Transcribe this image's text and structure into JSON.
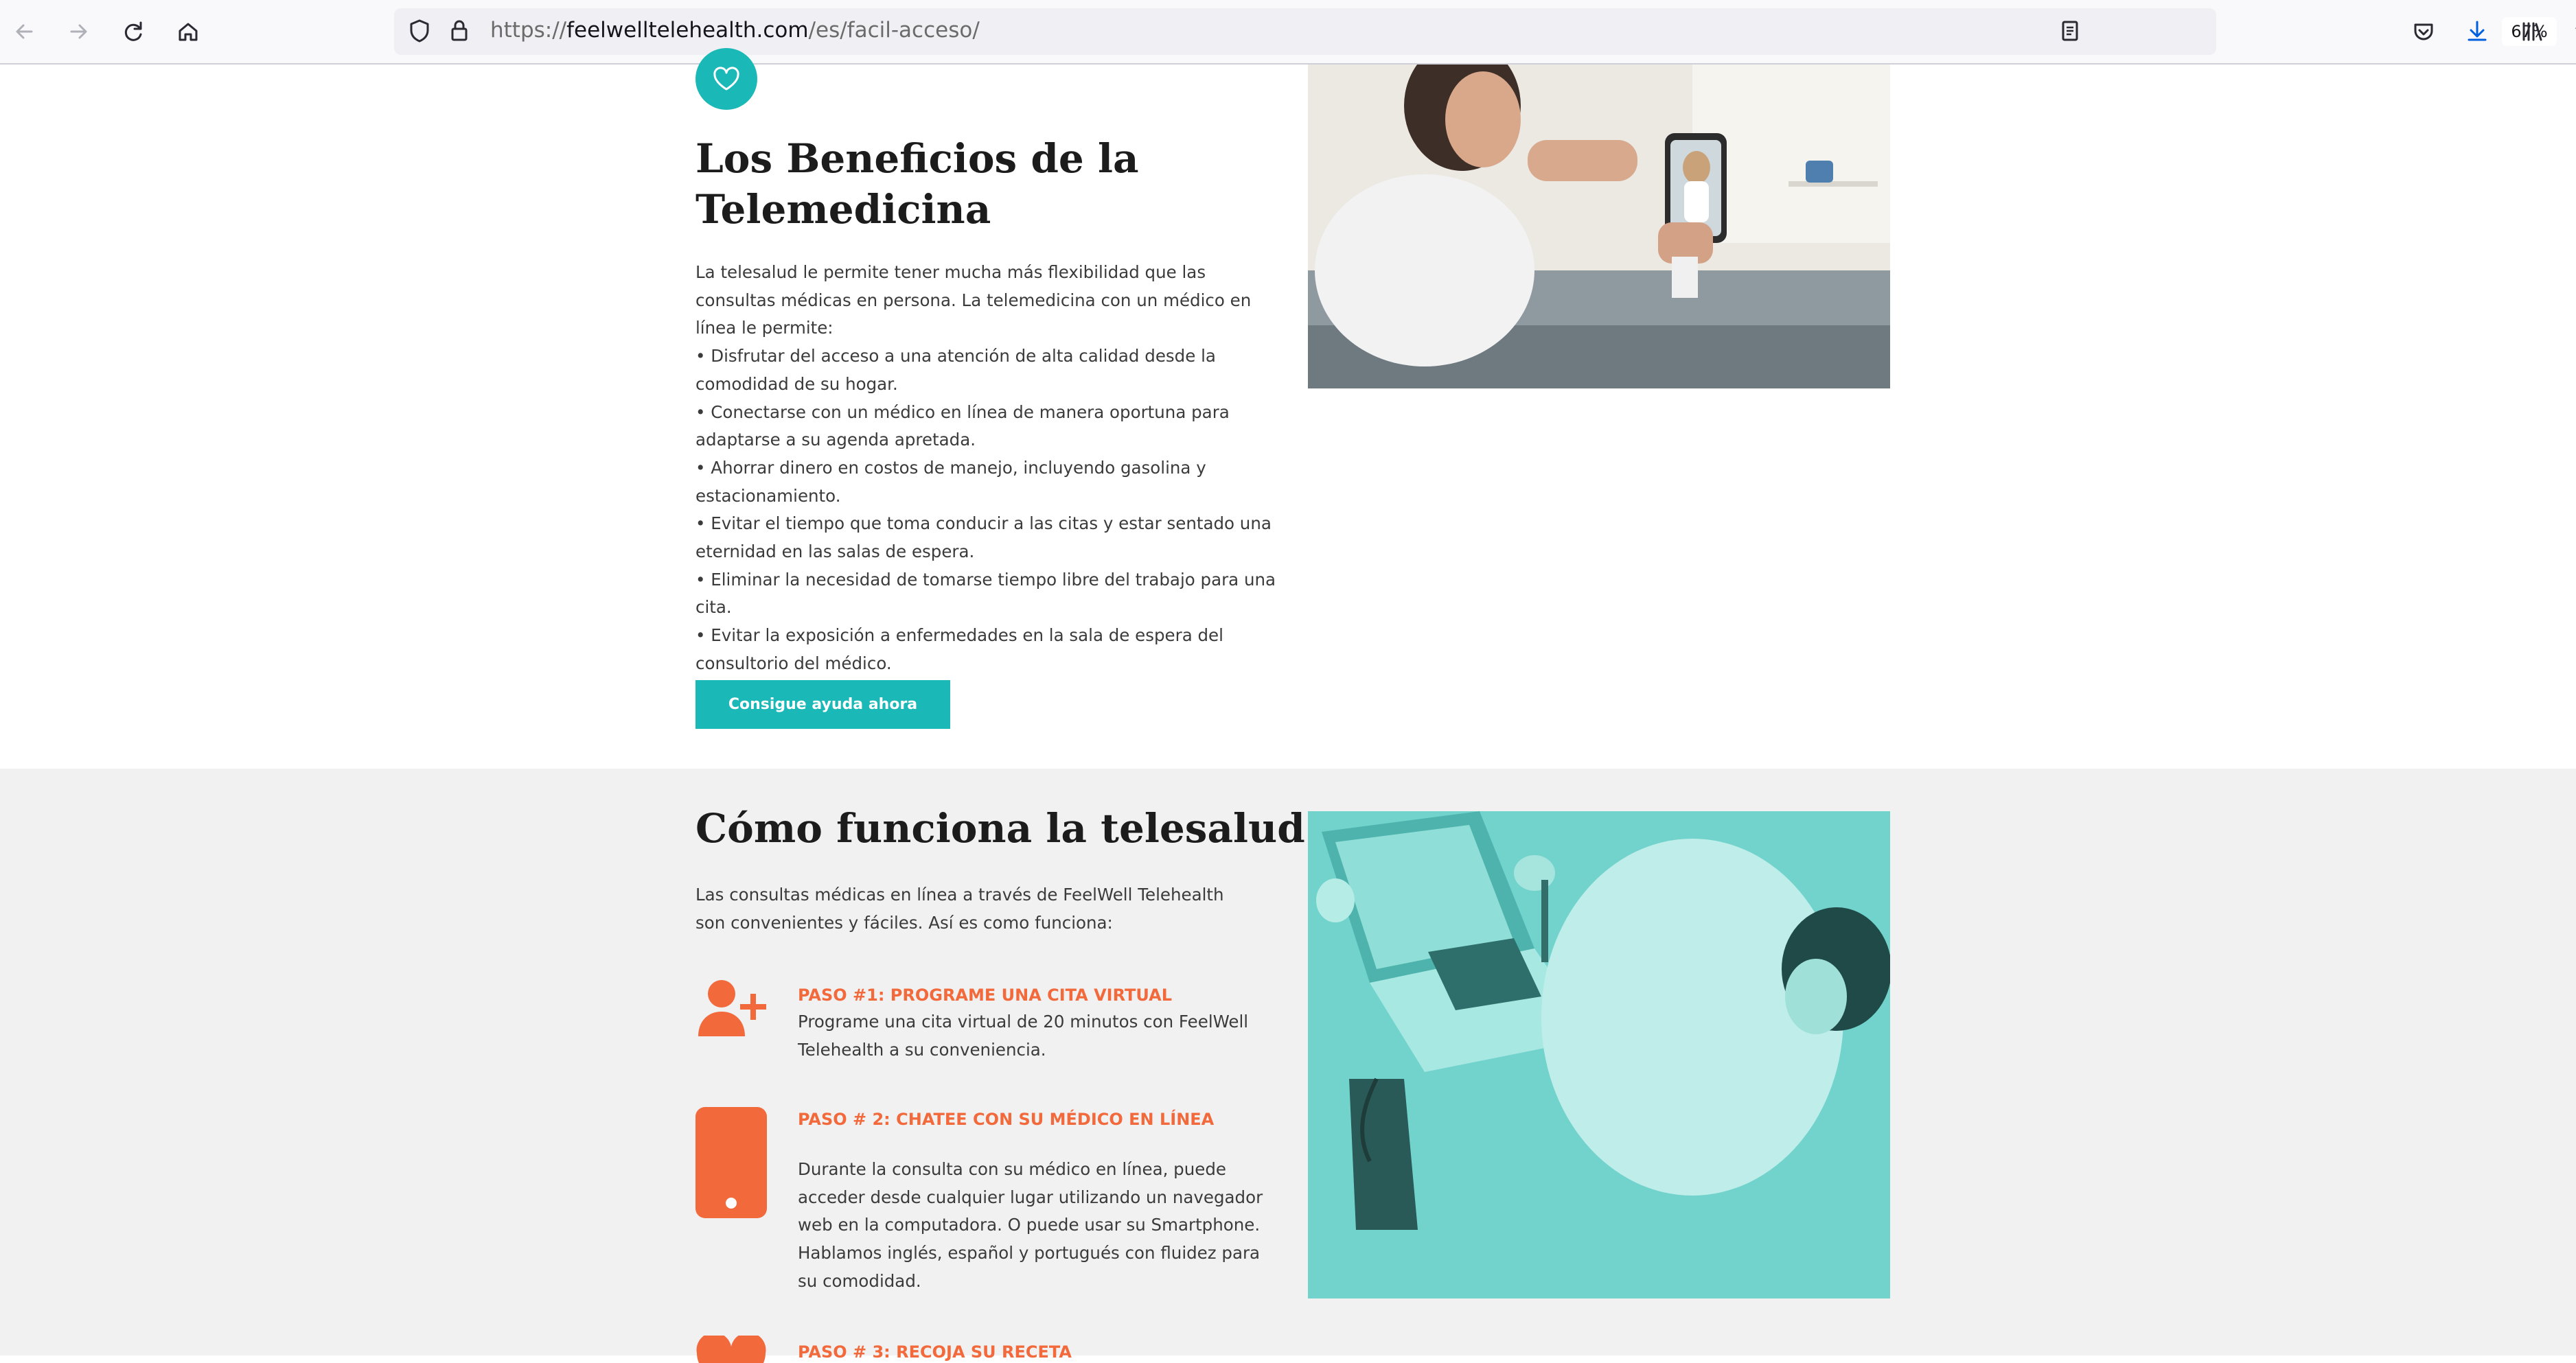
{
  "browser": {
    "url_prefix": "https://",
    "url_host": "feelwelltelehealth.com",
    "url_path": "/es/facil-acceso/",
    "zoom": "67%"
  },
  "section1": {
    "title": "Los Beneficios de la Telemedicina",
    "intro": "La telesalud le permite tener mucha más flexibilidad que las consultas médicas en persona. La telemedicina con un médico en línea le permite:",
    "bullets": [
      "• Disfrutar del acceso a una atención de alta calidad desde la comodidad de su hogar.",
      "• Conectarse con un médico en línea de manera oportuna para adaptarse a su agenda apretada.",
      "• Ahorrar dinero en costos de manejo, incluyendo gasolina y estacionamiento.",
      "• Evitar el tiempo que toma conducir a las citas y estar sentado una eternidad en las salas de espera.",
      "• Eliminar la necesidad de tomarse tiempo libre del trabajo para una cita.",
      "• Evitar la exposición a enfermedades en la sala de espera del consultorio del médico."
    ],
    "cta": "Consigue ayuda ahora"
  },
  "section2": {
    "title": "Cómo funciona la telesalud",
    "intro": "Las consultas médicas en línea a través de FeelWell Telehealth son convenientes y fáciles. Así es como funciona:",
    "steps": [
      {
        "title": "PASO #1: PROGRAME UNA CITA VIRTUAL",
        "desc": "Programe una cita virtual de 20 minutos con FeelWell Telehealth a su conveniencia."
      },
      {
        "title": "PASO # 2: CHATEE CON SU MÉDICO EN LÍNEA",
        "desc": "Durante la consulta con su médico en línea, puede acceder desde cualquier lugar utilizando un navegador web en la computadora. O puede usar su Smartphone. Hablamos inglés, español y portugués con fluidez para su comodidad."
      },
      {
        "title": "PASO # 3: RECOJA SU RECETA"
      }
    ]
  },
  "colors": {
    "teal": "#1bb8b8",
    "orange": "#f26a3c"
  }
}
